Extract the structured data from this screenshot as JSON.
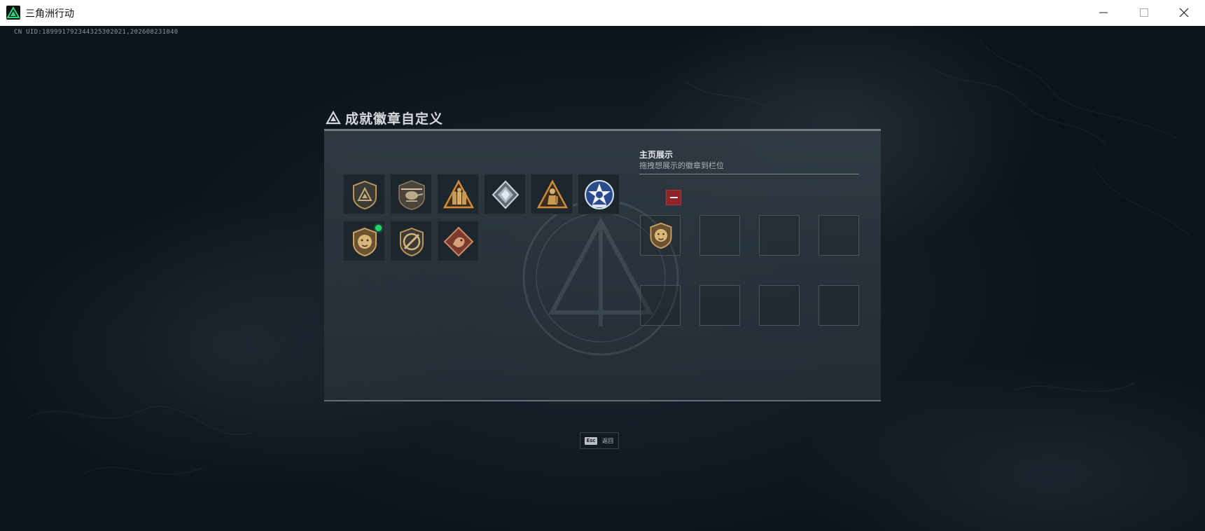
{
  "window": {
    "title": "三角洲行动",
    "app_icon": "delta-triangle-icon",
    "controls": [
      "minimize-icon",
      "maximize-icon",
      "close-icon"
    ]
  },
  "overlay": {
    "uid": "CN UID:189991792344325302021,202608231040"
  },
  "panel": {
    "title": "成就徽章自定义",
    "title_icon": "delta-triangle-icon"
  },
  "badges": [
    {
      "icon": "shield-triangle-badge-icon",
      "new": false
    },
    {
      "icon": "helicopter-badge-icon",
      "new": false
    },
    {
      "icon": "gold-soldiers-triangle-badge-icon",
      "new": false
    },
    {
      "icon": "diamond-gem-badge-icon",
      "new": false
    },
    {
      "icon": "gold-figure-triangle-badge-icon",
      "new": false
    },
    {
      "icon": "blue-star-emblem-badge-icon",
      "new": false
    },
    {
      "icon": "lion-shield-badge-icon",
      "new": true
    },
    {
      "icon": "crossed-sword-shield-badge-icon",
      "new": false
    },
    {
      "icon": "dragon-diamond-badge-icon",
      "new": false
    }
  ],
  "showcase": {
    "title": "主页展示",
    "subtitle": "拖拽想展示的徽章到栏位",
    "slots": [
      {
        "badge": "lion-shield-badge-icon"
      },
      {
        "badge": null
      },
      {
        "badge": null
      },
      {
        "badge": null
      },
      {
        "badge": null
      },
      {
        "badge": null
      },
      {
        "badge": null
      },
      {
        "badge": null
      }
    ],
    "remove_icon": "minus-icon"
  },
  "footer": {
    "esc_key": "Esc",
    "esc_label": "返回"
  },
  "colors": {
    "new_indicator": "#21d66d",
    "remove_button": "#8c2428",
    "badge_gold": "#b8935a",
    "badge_blue": "#2a4c8c"
  }
}
